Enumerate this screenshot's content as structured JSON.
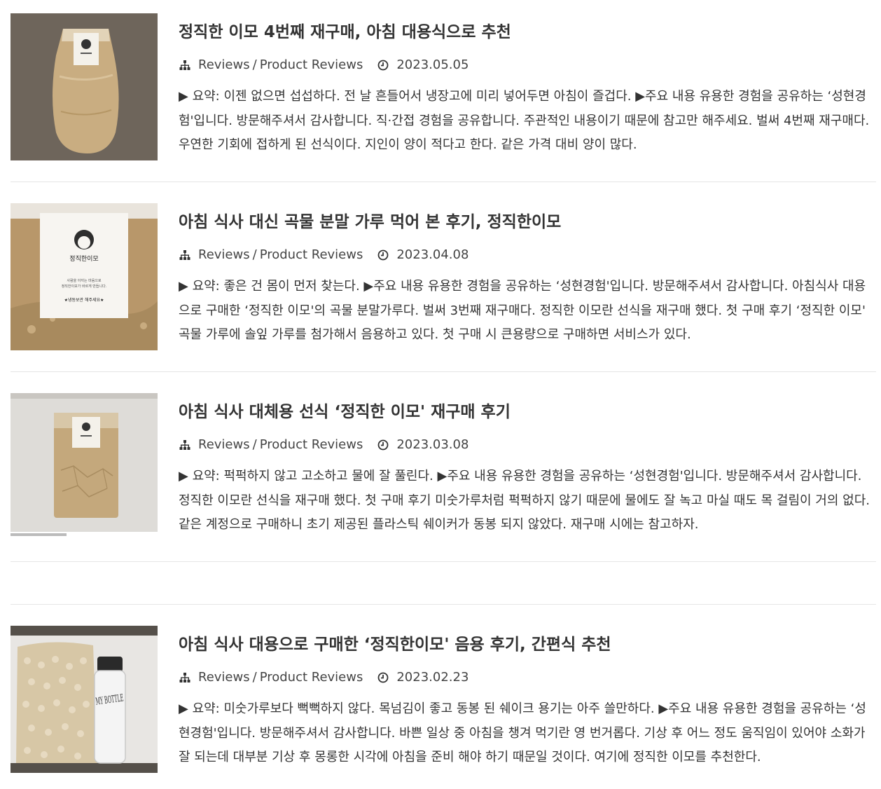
{
  "posts": [
    {
      "title": "정직한 이모 4번째 재구매, 아침 대용식으로 추천",
      "category": "Reviews",
      "subcategory": "Product Reviews",
      "date": "2023.05.05",
      "excerpt": "▶ 요약: 이젠 없으면 섭섭하다. 전 날 흔들어서 냉장고에 미리 넣어두면 아침이 즐겁다. ▶주요 내용 유용한 경험을 공유하는 ‘성현경험'입니다. 방문해주셔서 감사합니다. 직·간접 경험을 공유합니다. 주관적인 내용이기 때문에 참고만 해주세요. 벌써 4번째 재구매다. 우연한 기회에 접하게 된 선식이다. 지인이 양이 적다고 한다. 같은 가격 대비 양이 많다."
    },
    {
      "title": "아침 식사 대신 곡물 분말 가루 먹어 본 후기, 정직한이모",
      "category": "Reviews",
      "subcategory": "Product Reviews",
      "date": "2023.04.08",
      "excerpt": "▶ 요약: 좋은 건 몸이 먼저 찾는다. ▶주요 내용 유용한 경험을 공유하는 ‘성현경험'입니다. 방문해주셔서 감사합니다. 아침식사 대용으로 구매한 ‘정직한 이모'의 곡물 분말가루다. 벌써 3번째 재구매다. 정직한 이모란 선식을 재구매 했다. 첫 구매 후기 ‘정직한 이모' 곡물 가루에 솔잎 가루를 첨가해서 음용하고 있다. 첫 구매 시 큰용량으로 구매하면 서비스가 있다."
    },
    {
      "title": "아침 식사 대체용 선식 ‘정직한 이모' 재구매 후기",
      "category": "Reviews",
      "subcategory": "Product Reviews",
      "date": "2023.03.08",
      "excerpt": "▶ 요약: 퍽퍽하지 않고 고소하고 물에 잘 풀린다. ▶주요 내용 유용한 경험을 공유하는 ‘성현경험'입니다. 방문해주셔서 감사합니다. 정직한 이모란 선식을 재구매 했다. 첫 구매 후기 미숫가루처럼 퍽퍽하지 않기 때문에 물에도 잘 녹고 마실 때도 목 걸림이 거의 없다. 같은 계정으로 구매하니 초기 제공된 플라스틱 쉐이커가 동봉 되지 않았다. 재구매 시에는 참고하자."
    },
    {
      "title": "아침 식사 대용으로 구매한 ‘정직한이모' 음용 후기, 간편식 추천",
      "category": "Reviews",
      "subcategory": "Product Reviews",
      "date": "2023.02.23",
      "excerpt": "▶ 요약: 미숫가루보다 뻑뻑하지 않다. 목넘김이 좋고 동봉 된 쉐이크 용기는 아주 쓸만하다. ▶주요 내용 유용한 경험을 공유하는 ‘성현경험'입니다. 방문해주셔서 감사합니다. 바쁜 일상 중 아침을 챙겨 먹기란 영 번거롭다. 기상 후 어느 정도 움직임이 있어야 소화가 잘 되는데 대부분 기상 후 몽롱한 시각에 아침을 준비 해야 하기 때문일 것이다. 여기에 정직한 이모를 추천한다."
    }
  ],
  "separator": "/",
  "images": {
    "label_brand": "정직한이모",
    "label_desc_line1": "사람을 아끼는 마음으로",
    "label_desc_line2": "정직한이모가 바르게 만듭니다.",
    "label_storage": "★냉동보관 해주세요★",
    "bottle_text": "MY BOTTLE"
  },
  "colors": {
    "text": "#333333",
    "meta": "#444444",
    "divider": "#e5e5e5",
    "powder": "#c4a87c"
  }
}
